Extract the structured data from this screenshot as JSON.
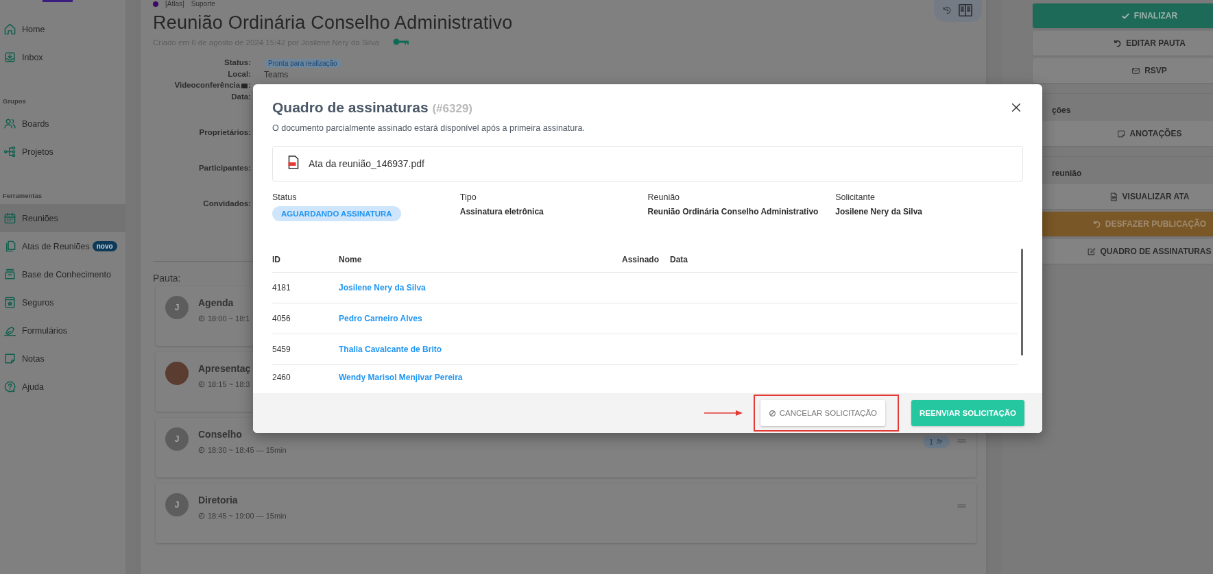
{
  "sidebar": {
    "sections": [
      {
        "items": [
          {
            "label": "Home",
            "selected": false
          },
          {
            "label": "Inbox",
            "selected": false
          }
        ]
      },
      {
        "title": "Grupos",
        "items": [
          {
            "label": "Boards",
            "selected": false
          },
          {
            "label": "Projetos",
            "selected": false
          }
        ]
      },
      {
        "title": "Ferramentas",
        "items": [
          {
            "label": "Reuniões",
            "selected": true
          },
          {
            "label": "Atas de Reuniões",
            "selected": false,
            "badge": "novo"
          },
          {
            "label": "Base de Conhecimento",
            "selected": false
          },
          {
            "label": "Seguros",
            "selected": false
          },
          {
            "label": "Formulários",
            "selected": false
          },
          {
            "label": "Notas",
            "selected": false
          },
          {
            "label": "Ajuda",
            "selected": false
          }
        ]
      }
    ]
  },
  "meeting": {
    "breadcrumb": [
      "[Atlas]",
      "Suporte"
    ],
    "title": "Reunião Ordinária Conselho Administrativo",
    "created": "Criado em 6 de agosto de 2024 15:42 por Josilene Nery da Silva",
    "details": [
      {
        "label": "Status:",
        "kind": "badge",
        "value": "Pronta para realização"
      },
      {
        "label": "Local:",
        "kind": "text",
        "value": "Teams"
      },
      {
        "label": "Videoconferência",
        "kind": "video",
        "label_end": ":"
      },
      {
        "label": "Data:",
        "kind": "empty"
      },
      {
        "label": "Proprietários:",
        "kind": "empty"
      },
      {
        "label": "Participantes:",
        "kind": "empty"
      },
      {
        "label": "Convidados:",
        "kind": "empty"
      }
    ],
    "agenda_label": "Pauta:",
    "agenda": [
      {
        "title": "Agenda",
        "time": "18:00 ~ 18:1",
        "kind": "initial",
        "initial": "J",
        "handle": false
      },
      {
        "title": "Apresentaç",
        "time": "18:15 ~ 18:3",
        "kind": "photo",
        "handle": false
      },
      {
        "title": "Conselho",
        "time": "18:30 ~ 18:45 — 15min",
        "kind": "initial",
        "initial": "J",
        "count": "1",
        "handle": true
      },
      {
        "title": "Diretoria",
        "time": "18:45 ~ 19:00 — 15min",
        "kind": "initial",
        "initial": "J",
        "handle": true
      }
    ]
  },
  "right_panel": {
    "groups": [
      {
        "buttons": [
          {
            "label": "FINALIZAR",
            "kind": "primary"
          },
          {
            "label": "EDITAR PAUTA",
            "kind": "default"
          },
          {
            "label": "RSVP",
            "kind": "default"
          }
        ]
      },
      {
        "title": "ções",
        "buttons": [
          {
            "label": "ANOTAÇÕES",
            "kind": "default"
          }
        ]
      },
      {
        "title": "reunião",
        "buttons": [
          {
            "label": "VISUALIZAR ATA",
            "kind": "default"
          },
          {
            "label": "DESFAZER PUBLICAÇÃO",
            "kind": "warning"
          },
          {
            "label": "QUADRO DE ASSINATURAS",
            "kind": "default"
          }
        ]
      }
    ]
  },
  "modal": {
    "title": "Quadro de assinaturas",
    "ref": "(#6329)",
    "note": "O documento parcialmente assinado estará disponível após a primeira assinatura.",
    "file": {
      "name": "Ata da reunião_146937.pdf"
    },
    "info": [
      {
        "label": "Status",
        "kind": "badge",
        "value": "AGUARDANDO ASSINATURA"
      },
      {
        "label": "Tipo",
        "kind": "text",
        "value": "Assinatura eletrônica"
      },
      {
        "label": "Reunião",
        "kind": "text",
        "value": "Reunião Ordinária Conselho Administrativo"
      },
      {
        "label": "Solicitante",
        "kind": "text",
        "value": "Josilene Nery da Silva"
      }
    ],
    "table": {
      "columns": [
        "ID",
        "Nome",
        "Assinado",
        "Data"
      ],
      "rows": [
        {
          "id": "4181",
          "name": "Josilene Nery da Silva"
        },
        {
          "id": "4056",
          "name": "Pedro Carneiro Alves"
        },
        {
          "id": "5459",
          "name": "Thalia Cavalcante de Brito"
        },
        {
          "id": "2460",
          "name": "Wendy Marisol Menjivar Pereira"
        }
      ]
    },
    "buttons": [
      {
        "label": "CANCELAR SOLICITAÇÃO",
        "kind": "secondary",
        "highlighted": true
      },
      {
        "label": "REENVIAR SOLICITAÇÃO",
        "kind": "primary",
        "highlighted": false
      }
    ]
  }
}
